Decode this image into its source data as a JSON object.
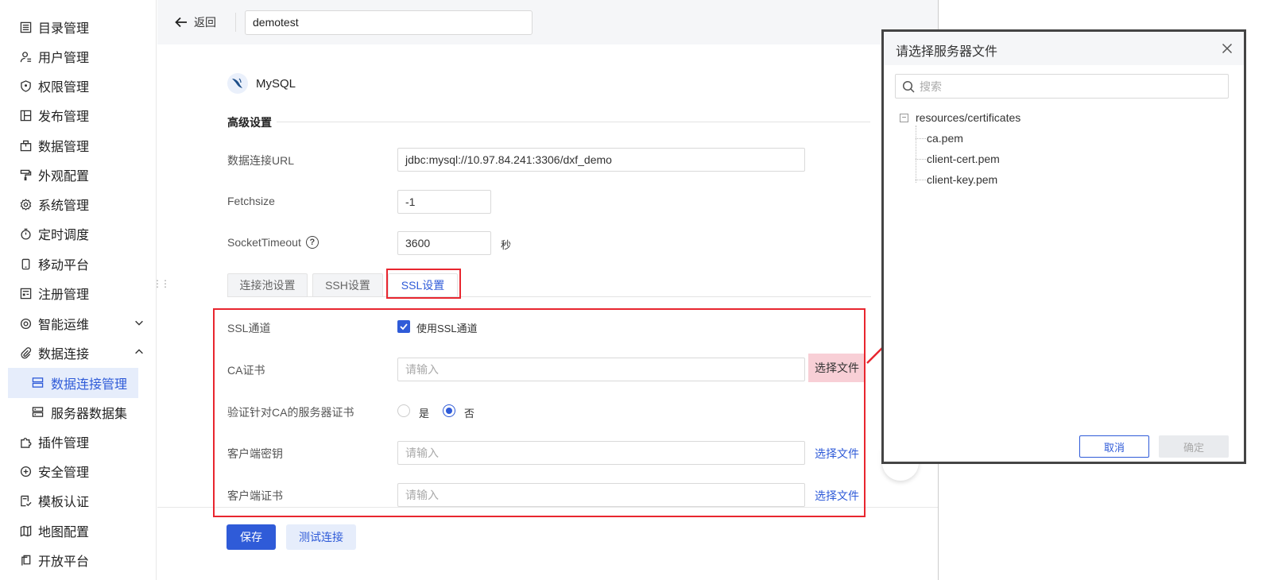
{
  "sidebar": {
    "items": [
      {
        "label": "目录管理"
      },
      {
        "label": "用户管理"
      },
      {
        "label": "权限管理"
      },
      {
        "label": "发布管理"
      },
      {
        "label": "数据管理"
      },
      {
        "label": "外观配置"
      },
      {
        "label": "系统管理"
      },
      {
        "label": "定时调度"
      },
      {
        "label": "移动平台"
      },
      {
        "label": "注册管理"
      },
      {
        "label": "智能运维"
      },
      {
        "label": "数据连接"
      },
      {
        "label": "插件管理"
      },
      {
        "label": "安全管理"
      },
      {
        "label": "模板认证"
      },
      {
        "label": "地图配置"
      },
      {
        "label": "开放平台"
      }
    ],
    "sub_items": [
      {
        "label": "数据连接管理",
        "active": true
      },
      {
        "label": "服务器数据集",
        "active": false
      }
    ]
  },
  "topbar": {
    "back_label": "返回",
    "connection_name": "demotest"
  },
  "form": {
    "db_type": "MySQL",
    "section_title": "高级设置",
    "url_label": "数据连接URL",
    "url_value": "jdbc:mysql://10.97.84.241:3306/dxf_demo",
    "fetchsize_label": "Fetchsize",
    "fetchsize_value": "-1",
    "socket_label": "SocketTimeout",
    "socket_value": "3600",
    "socket_unit": "秒",
    "tabs": [
      {
        "label": "连接池设置"
      },
      {
        "label": "SSH设置"
      },
      {
        "label": "SSL设置"
      }
    ],
    "ssl_channel_label": "SSL通道",
    "ssl_checkbox_label": "使用SSL通道",
    "ssl_checked": true,
    "ca_label": "CA证书",
    "input_placeholder": "请输入",
    "choose_file": "选择文件",
    "verify_label": "验证针对CA的服务器证书",
    "yes_label": "是",
    "no_label": "否",
    "verify_value": "否",
    "client_key_label": "客户端密钥",
    "client_cert_label": "客户端证书",
    "save_label": "保存",
    "test_label": "测试连接"
  },
  "dialog": {
    "title": "请选择服务器文件",
    "search_placeholder": "搜索",
    "tree_root": "resources/certificates",
    "files": [
      "ca.pem",
      "client-cert.pem",
      "client-key.pem"
    ],
    "cancel_label": "取消",
    "ok_label": "确定"
  },
  "colors": {
    "accent": "#2f5bd8",
    "highlight": "#e8262f"
  }
}
